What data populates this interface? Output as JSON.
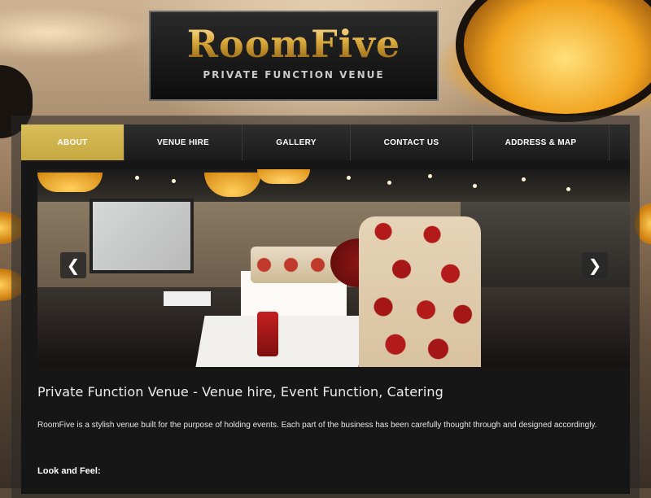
{
  "logo": {
    "name": "RoomFive",
    "tagline": "PRIVATE FUNCTION VENUE"
  },
  "nav": {
    "items": [
      {
        "label": "ABOUT",
        "active": true
      },
      {
        "label": "VENUE HIRE",
        "active": false
      },
      {
        "label": "GALLERY",
        "active": false
      },
      {
        "label": "CONTACT US",
        "active": false
      },
      {
        "label": "ADDRESS & MAP",
        "active": false
      }
    ]
  },
  "slider": {
    "prev_icon": "chevron-left-icon",
    "next_icon": "chevron-right-icon",
    "prev_glyph": "❮",
    "next_glyph": "❯"
  },
  "main": {
    "heading": "Private Function Venue - Venue hire, Event Function, Catering",
    "intro": "RoomFive is a stylish venue built for the purpose of holding events. Each part of the business has been carefully thought through and designed accordingly.",
    "subheading": "Look and Feel:"
  },
  "colors": {
    "accent": "#c9ad48",
    "nav_bg": "#222222",
    "content_bg": "#161616"
  }
}
